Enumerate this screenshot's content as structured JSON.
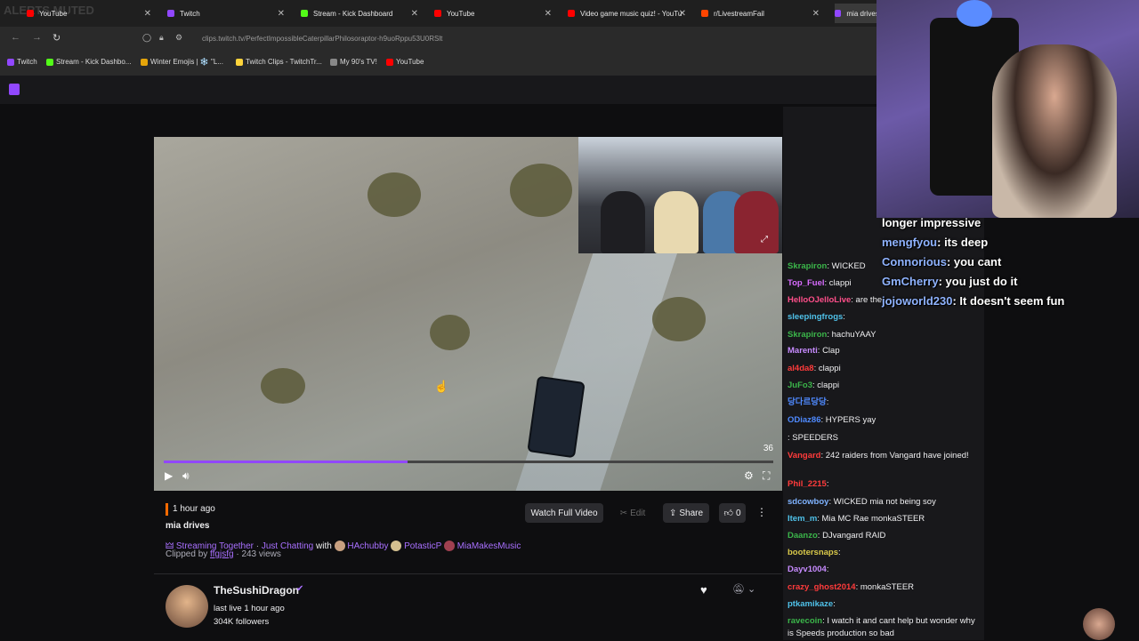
{
  "browser": {
    "watermark": "ALERTS MUTED",
    "tabs": [
      {
        "label": "YouTube",
        "color": "#ff0000"
      },
      {
        "label": "Twitch",
        "color": "#9147ff"
      },
      {
        "label": "Stream - Kick Dashboard",
        "color": "#53fc18"
      },
      {
        "label": "YouTube",
        "color": "#ff0000"
      },
      {
        "label": "Video game music quiz! - YouTu",
        "color": "#ff0000"
      },
      {
        "label": "r/LivestreamFail",
        "color": "#ff4500"
      },
      {
        "label": "mia drives",
        "color": "#9147ff"
      }
    ],
    "url": "clips.twitch.tv/PerfectImpossibleCaterpillarPhilosoraptor-h9uoRppu53U0RSlt",
    "bookmarks": [
      {
        "label": "Twitch",
        "color": "#9147ff"
      },
      {
        "label": "Stream - Kick Dashbo...",
        "color": "#53fc18"
      },
      {
        "label": "Winter Emojis | ❄️ \"L...",
        "color": "#e5a50a"
      },
      {
        "label": "Twitch Clips - TwitchTr...",
        "color": "#ffd43b"
      },
      {
        "label": "My 90's TV!",
        "color": "#888888"
      },
      {
        "label": "YouTube",
        "color": "#ff0000"
      }
    ]
  },
  "player": {
    "time_remaining": "36",
    "progress": 0.4
  },
  "clip": {
    "age": "1 hour ago",
    "title": "mia drives",
    "streaming_together": "Streaming Together",
    "category": "Just Chatting",
    "with": "with",
    "collaborators": [
      "HAchubby",
      "PotasticP",
      "MiaMakesMusic"
    ],
    "clipped_by_label": "Clipped by",
    "clipped_by": "ffgjsfg",
    "views": "243 views",
    "watch_full": "Watch Full Video",
    "edit": "Edit",
    "share": "Share",
    "likes": "0"
  },
  "channel": {
    "name": "TheSushiDragon",
    "status": "last live 1 hour ago",
    "followers": "304K followers"
  },
  "chat": [
    {
      "user": "Skrapiron",
      "color": "#3bb54a",
      "text": ": WICKED"
    },
    {
      "user": "Top_Fuel",
      "color": "#d96cff",
      "text": ": clappi"
    },
    {
      "user": "HelloOJelloLive",
      "color": "#ff4f8a",
      "text": ": are the"
    },
    {
      "user": "sleepingfrogs",
      "color": "#4fc1e9",
      "text": ":"
    },
    {
      "user": "Skrapiron",
      "color": "#3bb54a",
      "text": ": hachuYAAY"
    },
    {
      "user": "Marenti",
      "color": "#c78bff",
      "text": ": Clap"
    },
    {
      "user": "al4da8",
      "color": "#ff3b3b",
      "text": ": clappi"
    },
    {
      "user": "JuFo3",
      "color": "#3bb54a",
      "text": ": clappi"
    },
    {
      "user": "당다르당당",
      "color": "#4f8aff",
      "text": ":"
    },
    {
      "user": "ODiaz86",
      "color": "#4f8aff",
      "text": ": HYPERS yay"
    },
    {
      "user": "",
      "color": "#2a2aff",
      "text": ": SPEEDERS"
    },
    {
      "user": "Vangard",
      "color": "#ff3b3b",
      "text": ": 242 raiders from Vangard have joined!"
    },
    {
      "user": "Phil_2215",
      "color": "#ff3b3b",
      "text": ":"
    },
    {
      "user": "sdcowboy",
      "color": "#7fb3ff",
      "text": ": WICKED mia not being soy"
    },
    {
      "user": "Item_m",
      "color": "#4fc1e9",
      "text": ": Mia MC Rae monkaSTEER"
    },
    {
      "user": "Daanzo",
      "color": "#3bb54a",
      "text": ": DJvangard RAID"
    },
    {
      "user": "bootersnaps",
      "color": "#d9c94a",
      "text": ":"
    },
    {
      "user": "Dayv1004",
      "color": "#c78bff",
      "text": ":"
    },
    {
      "user": "crazy_ghost2014",
      "color": "#ff3b3b",
      "text": ": monkaSTEER"
    },
    {
      "user": "ptkamikaze",
      "color": "#4fc1e9",
      "text": ":"
    },
    {
      "user": "ravecoin",
      "color": "#3bb54a",
      "text": ": I watch it and cant help but wonder why is Speeds production so bad"
    }
  ],
  "overlay": [
    {
      "user": "",
      "text": "longer impressive"
    },
    {
      "user": "mengfyou",
      "text": ": its deep"
    },
    {
      "user": "Connorious",
      "text": ": you cant"
    },
    {
      "user": "GmCherry",
      "text": ": you just do it"
    },
    {
      "user": "jojoworld230",
      "text": ": It doesn't seem fun"
    }
  ]
}
